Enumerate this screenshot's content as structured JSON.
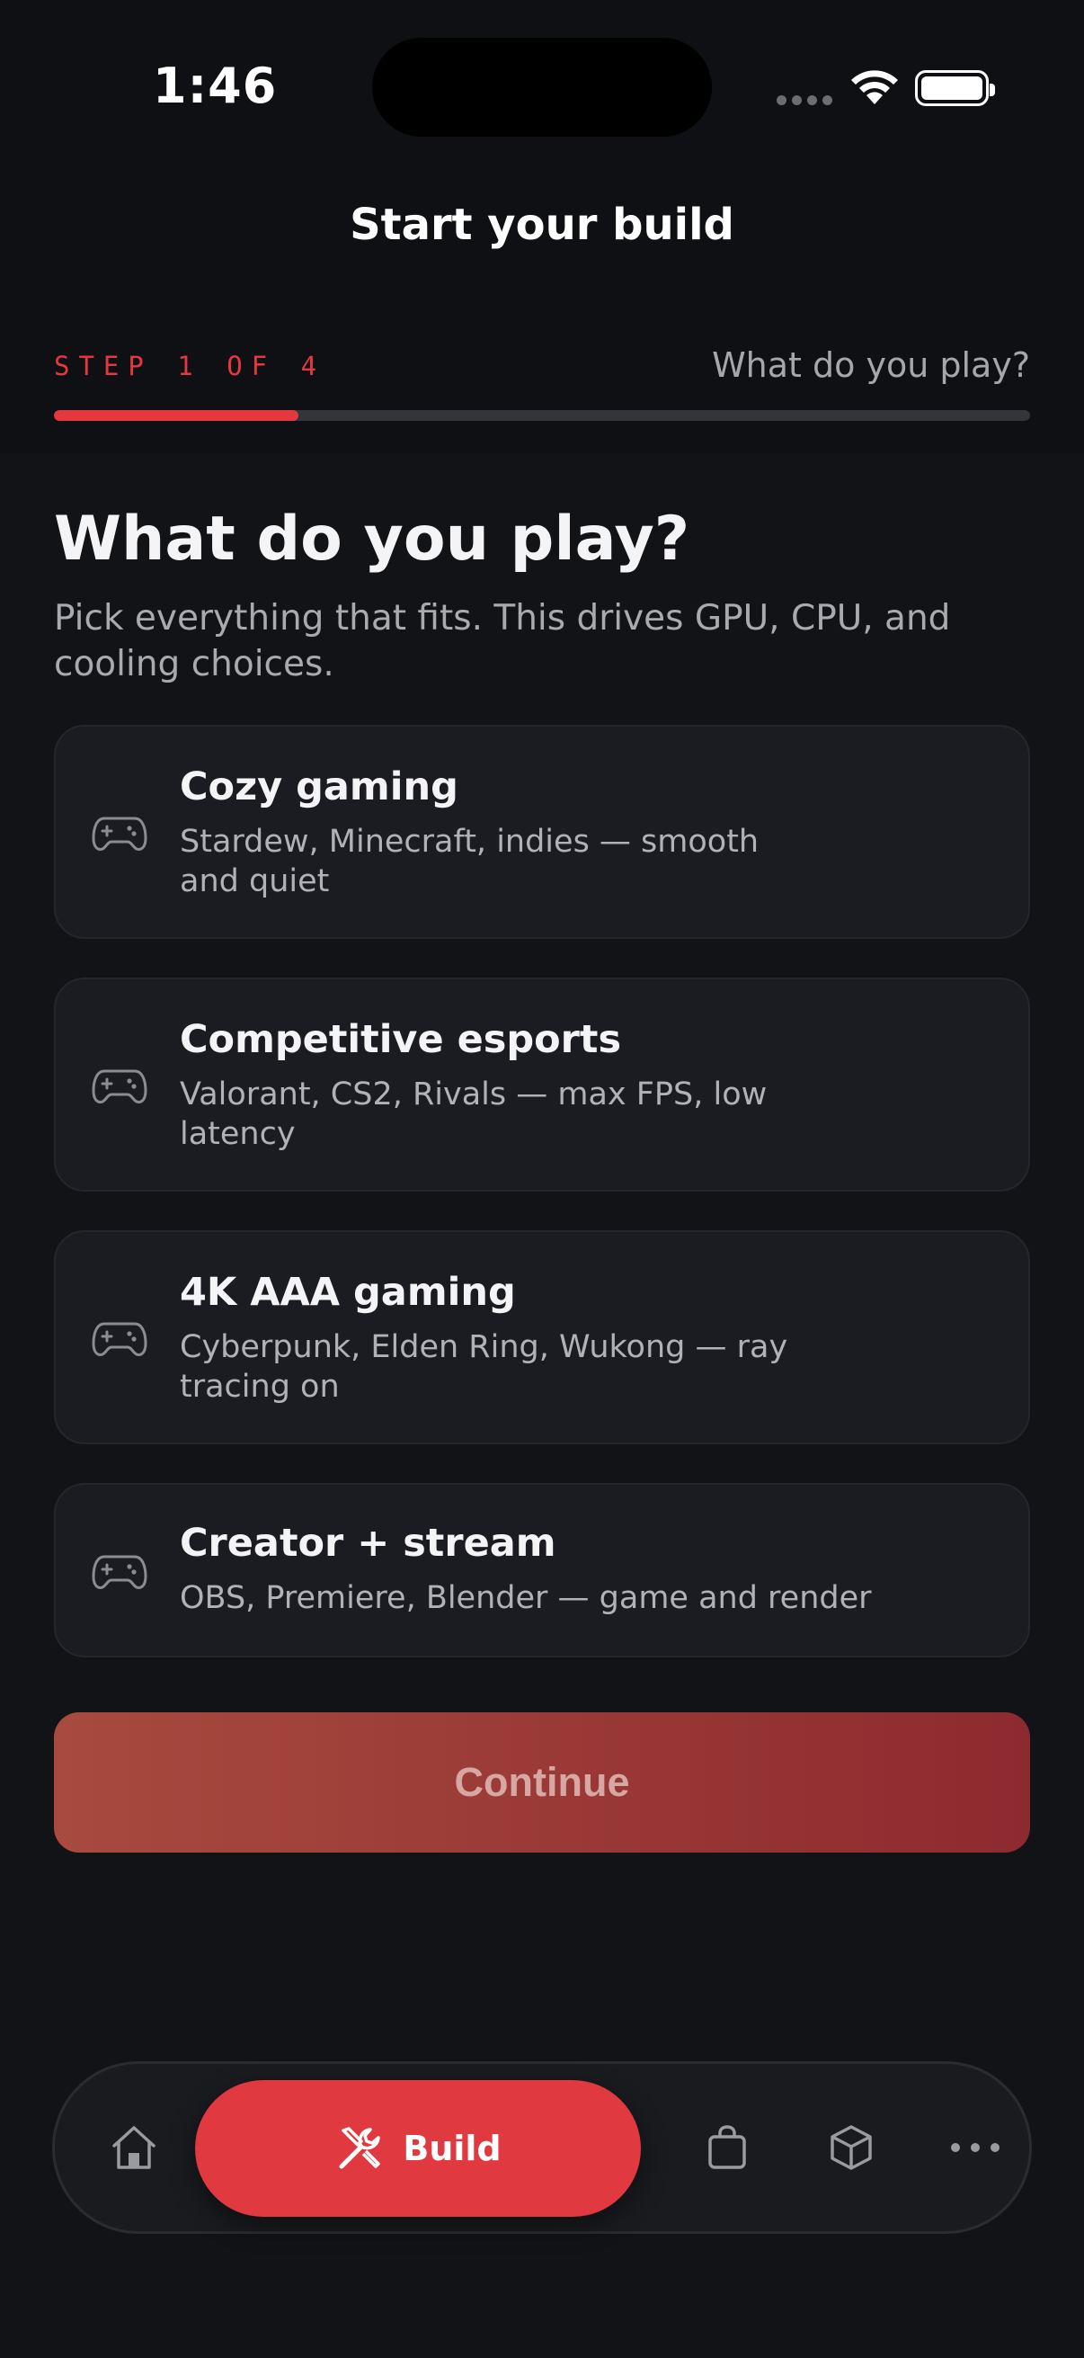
{
  "status_bar": {
    "time": "1:46"
  },
  "header": {
    "title": "Start your build",
    "step_label": "STEP 1 OF 4",
    "step_question": "What do you play?",
    "progress": 0.25
  },
  "main": {
    "heading": "What do you play?",
    "subheading": "Pick everything that fits. This drives GPU, CPU, and cooling choices.",
    "options": [
      {
        "title": "Cozy gaming",
        "description": "Stardew, Minecraft, indies — smooth and quiet",
        "icon": "gamepad-icon"
      },
      {
        "title": "Competitive esports",
        "description": "Valorant, CS2, Rivals — max FPS, low latency",
        "icon": "gamepad-icon"
      },
      {
        "title": "4K AAA gaming",
        "description": "Cyberpunk, Elden Ring, Wukong — ray tracing on",
        "icon": "gamepad-icon"
      },
      {
        "title": "Creator + stream",
        "description": "OBS, Premiere, Blender — game and render",
        "icon": "gamepad-icon"
      }
    ],
    "continue_label": "Continue"
  },
  "tab_bar": {
    "items": [
      {
        "name": "home",
        "icon": "home-icon"
      },
      {
        "name": "build",
        "label": "Build",
        "icon": "tools-icon",
        "active": true
      },
      {
        "name": "shop",
        "icon": "shopping-bag-icon"
      },
      {
        "name": "orders",
        "icon": "box-icon"
      },
      {
        "name": "more",
        "icon": "more-icon"
      }
    ]
  },
  "colors": {
    "accent": "#e0393f",
    "background": "#121317",
    "card": "#1b1c21"
  }
}
